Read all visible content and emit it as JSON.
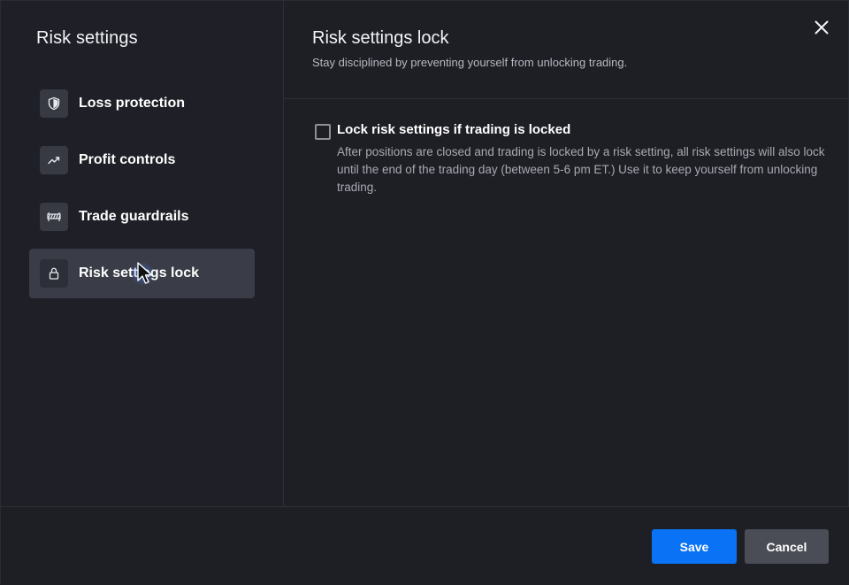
{
  "sidebar": {
    "title": "Risk settings",
    "items": [
      {
        "label": "Loss protection",
        "icon": "shield-icon",
        "active": false
      },
      {
        "label": "Profit controls",
        "icon": "trending-up-icon",
        "active": false
      },
      {
        "label": "Trade guardrails",
        "icon": "barrier-icon",
        "active": false
      },
      {
        "label": "Risk settings lock",
        "icon": "lock-icon",
        "active": true
      }
    ]
  },
  "main": {
    "title": "Risk settings lock",
    "subtitle": "Stay disciplined by preventing yourself from unlocking trading.",
    "option": {
      "label": "Lock risk settings if trading is locked",
      "checked": false,
      "description": "After positions are closed and trading is locked by a risk setting, all risk settings will also lock until the end of the trading day (between 5-6 pm ET.) Use it to keep yourself from unlocking trading."
    }
  },
  "footer": {
    "save_label": "Save",
    "cancel_label": "Cancel"
  },
  "colors": {
    "background": "#1e1f25",
    "active_item": "#3a3d47",
    "accent": "#0a72f5",
    "cancel": "#4a4d56"
  }
}
